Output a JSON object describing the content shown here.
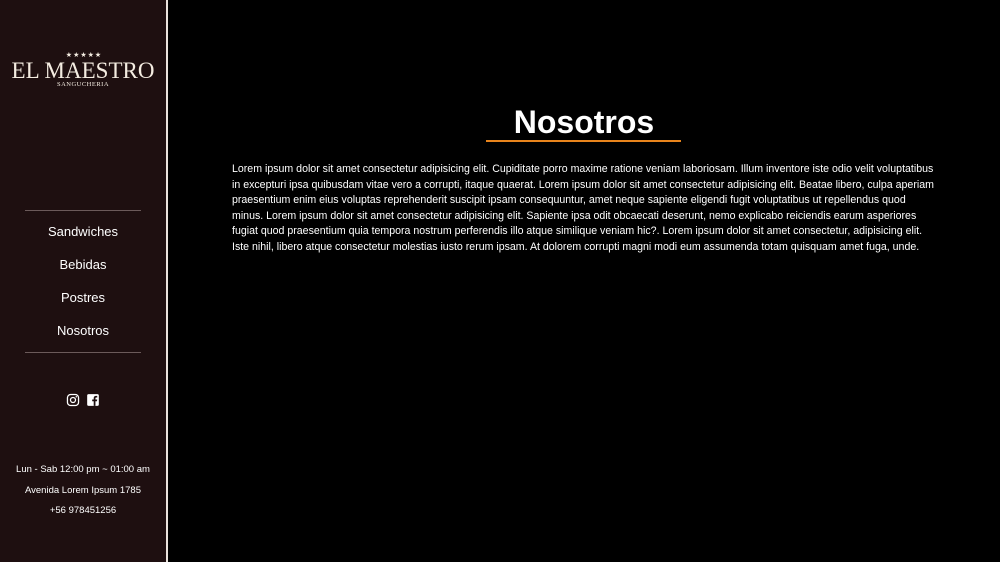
{
  "brand": {
    "stars": "★★★★★",
    "name": "EL MAESTRO",
    "subtitle": "SANGUCHERIA"
  },
  "nav": {
    "items": [
      {
        "label": "Sandwiches"
      },
      {
        "label": "Bebidas"
      },
      {
        "label": "Postres"
      },
      {
        "label": "Nosotros"
      }
    ]
  },
  "social": {
    "icons": [
      "instagram-icon",
      "facebook-icon"
    ]
  },
  "info": {
    "hours": "Lun - Sab 12:00 pm ~ 01:00 am",
    "address": "Avenida Lorem Ipsum 1785",
    "phone": "+56 978451256"
  },
  "main": {
    "title": "Nosotros",
    "body": "Lorem ipsum dolor sit amet consectetur adipisicing elit. Cupiditate porro maxime ratione veniam laboriosam. Illum inventore iste odio velit voluptatibus in excepturi ipsa quibusdam vitae vero a corrupti, itaque quaerat. Lorem ipsum dolor sit amet consectetur adipisicing elit. Beatae libero, culpa aperiam praesentium enim eius voluptas reprehenderit suscipit ipsam consequuntur, amet neque sapiente eligendi fugit voluptatibus ut repellendus quod minus. Lorem ipsum dolor sit amet consectetur adipisicing elit. Sapiente ipsa odit obcaecati deserunt, nemo explicabo reiciendis earum asperiores fugiat quod praesentium quia tempora nostrum perferendis illo atque similique veniam hic?. Lorem ipsum dolor sit amet consectetur, adipisicing elit. Iste nihil, libero atque consectetur molestias iusto rerum ipsam. At dolorem corrupti magni modi eum assumenda totam quisquam amet fuga, unde."
  },
  "colors": {
    "sidebar_bg": "#1e0f10",
    "main_bg": "#000000",
    "accent": "#e8841c",
    "text": "#ffffff"
  }
}
